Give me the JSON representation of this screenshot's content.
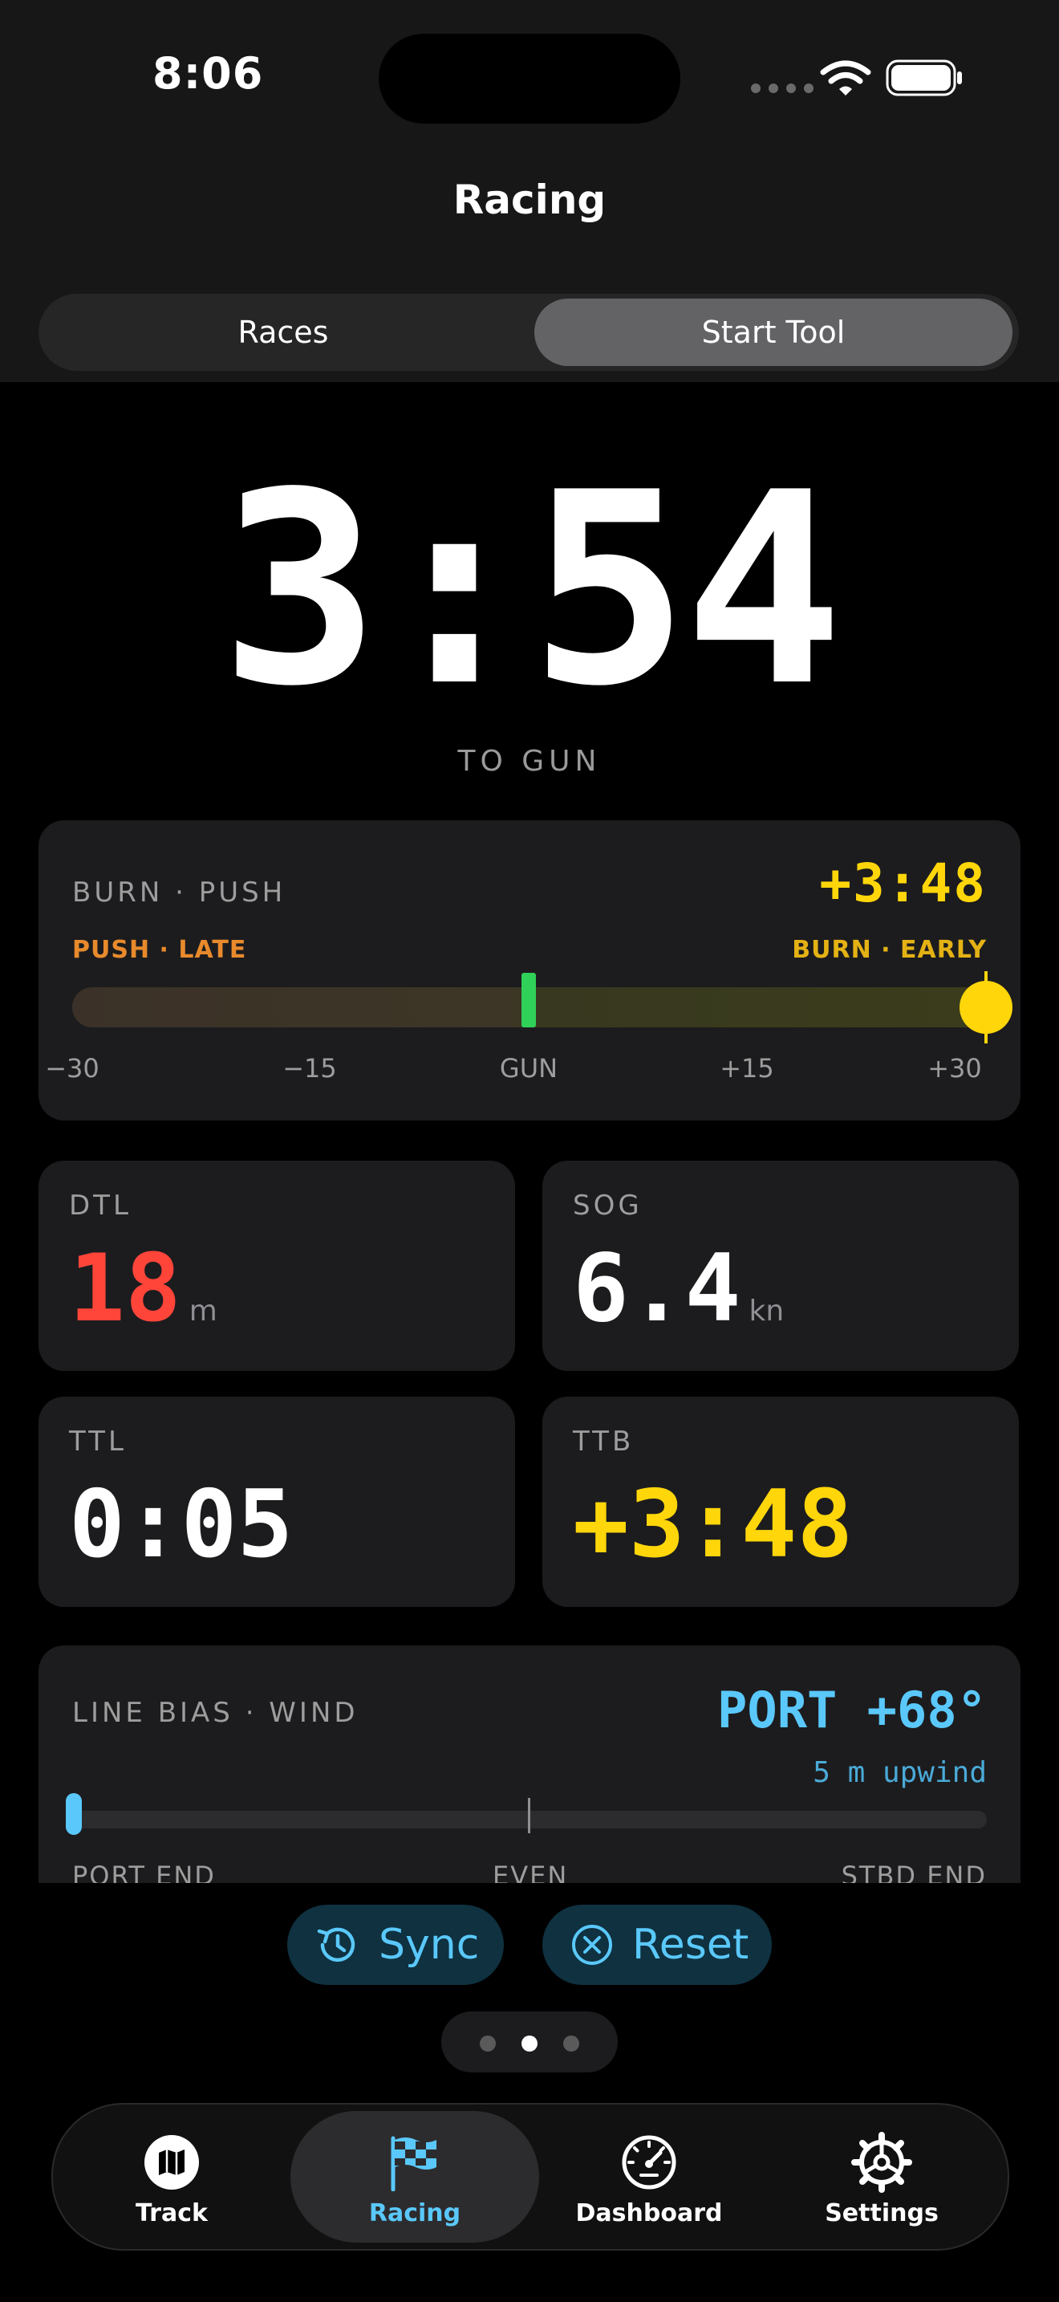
{
  "status": {
    "time": "8:06"
  },
  "nav": {
    "title": "Racing"
  },
  "segments": {
    "races": "Races",
    "start_tool": "Start Tool",
    "selected": "Start Tool"
  },
  "countdown": {
    "value": "3:54",
    "label": "TO GUN"
  },
  "burn": {
    "title": "BURN · PUSH",
    "value": "+3:48",
    "left_label": "PUSH · LATE",
    "right_label": "BURN · EARLY",
    "ticks": [
      "−30",
      "−15",
      "GUN",
      "+15",
      "+30"
    ],
    "colors": {
      "value": "#ffd60a",
      "gun": "#30d158",
      "push": "#e88a2c"
    }
  },
  "stats": {
    "dtl": {
      "label": "DTL",
      "value": "18",
      "unit": "m",
      "color": "#ff453a"
    },
    "sog": {
      "label": "SOG",
      "value": "6.4",
      "unit": "kn"
    },
    "ttl": {
      "label": "TTL",
      "value": "0:05"
    },
    "ttb": {
      "label": "TTB",
      "value": "+3:48",
      "color": "#ffd60a"
    }
  },
  "bias": {
    "title": "LINE BIAS · WIND",
    "value": "PORT +68°",
    "sub": "5 m upwind",
    "labels": [
      "PORT END",
      "EVEN",
      "STBD END"
    ],
    "color": "#5ac8fa"
  },
  "actions": {
    "sync": "Sync",
    "reset": "Reset"
  },
  "pager": {
    "count": 3,
    "active": 2
  },
  "tabs": [
    {
      "label": "Track",
      "icon": "map-icon"
    },
    {
      "label": "Racing",
      "icon": "checkered-flag-icon",
      "active": true
    },
    {
      "label": "Dashboard",
      "icon": "gauge-icon"
    },
    {
      "label": "Settings",
      "icon": "gear-icon"
    }
  ]
}
